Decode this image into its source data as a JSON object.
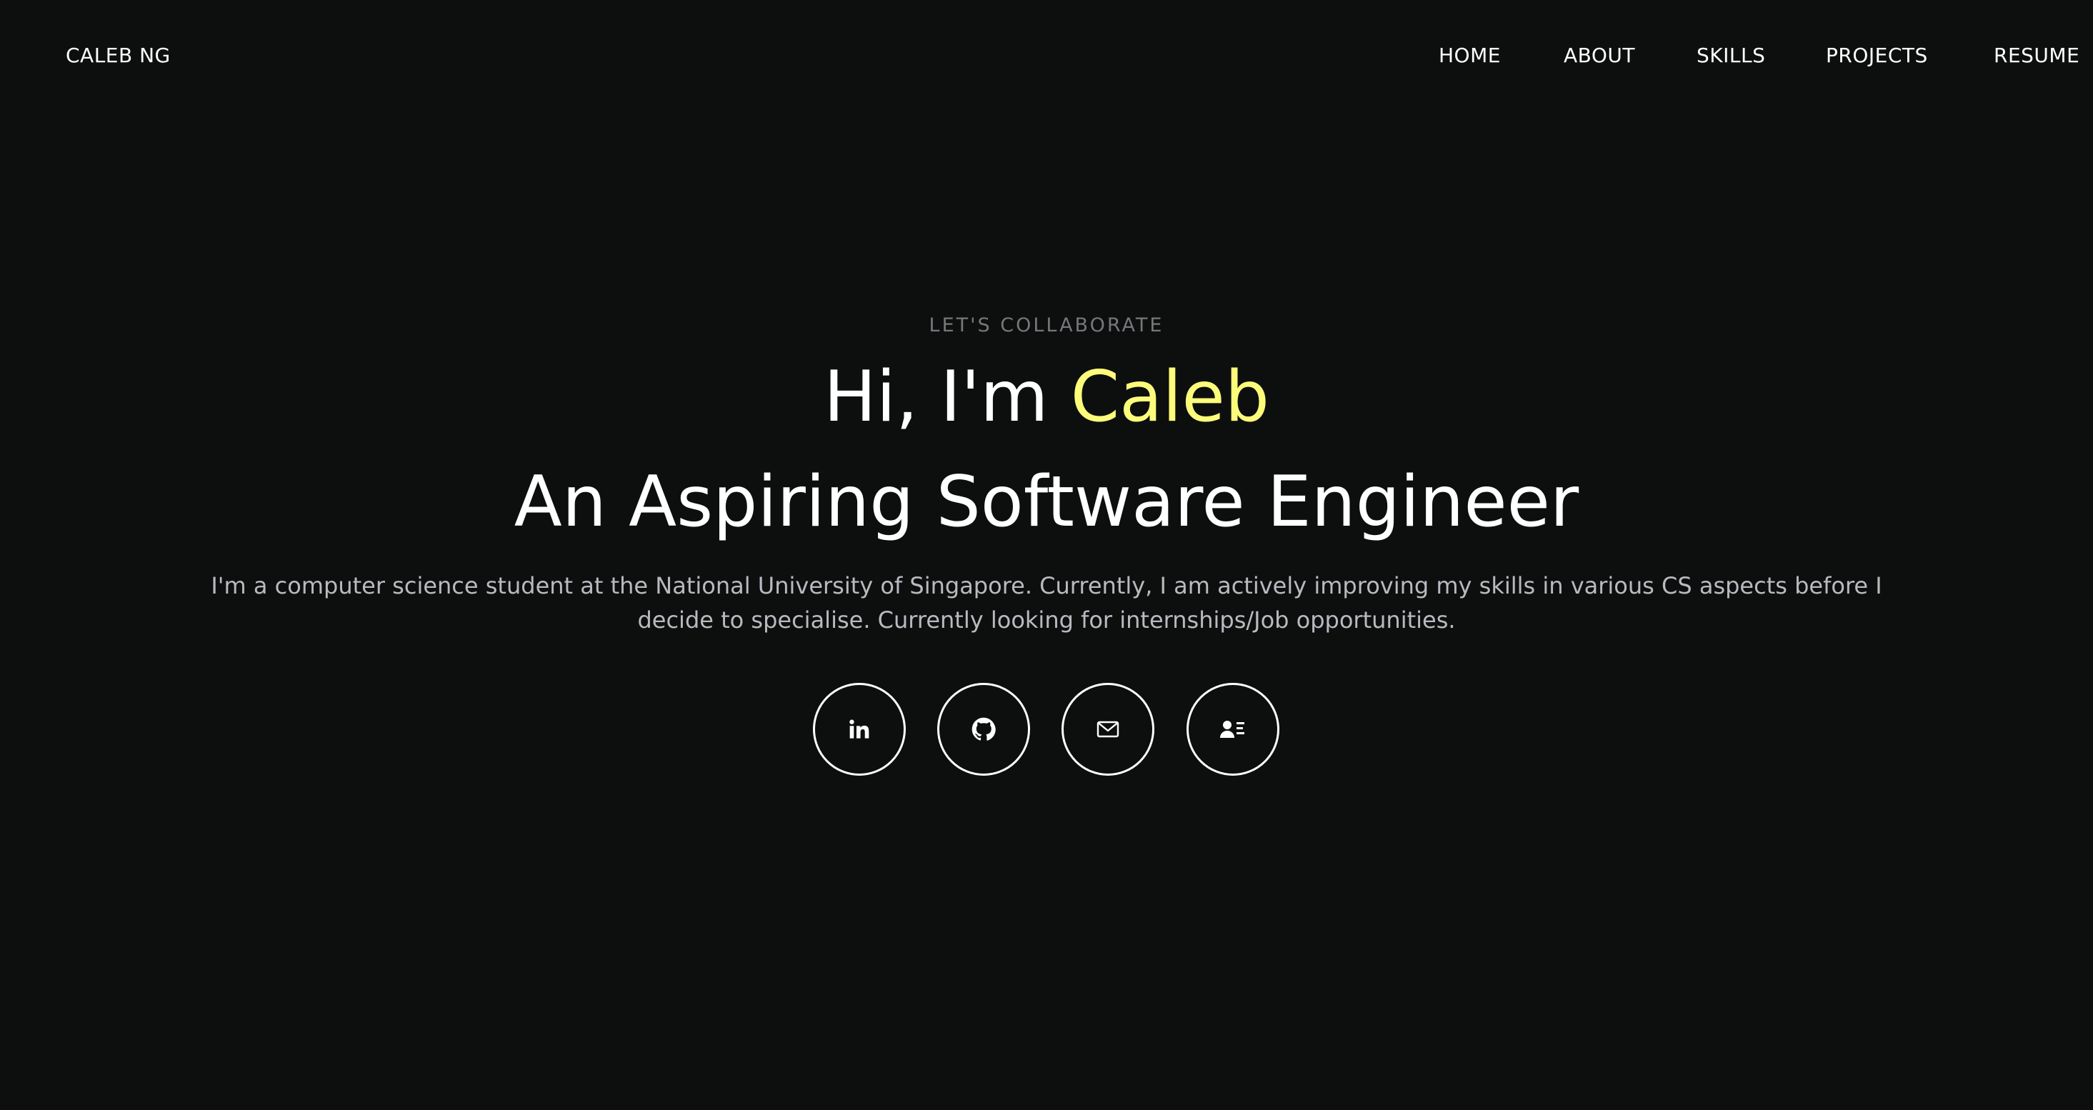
{
  "header": {
    "brand": "CALEB NG",
    "nav": [
      "HOME",
      "ABOUT",
      "SKILLS",
      "PROJECTS",
      "RESUME"
    ]
  },
  "hero": {
    "eyebrow": "LET'S COLLABORATE",
    "greeting_prefix": "Hi, I'm ",
    "greeting_name": "Caleb",
    "role": "An Aspiring Software Engineer",
    "description": "I'm a computer science student at the National University of Singapore. Currently, I am actively improving my skills in various CS aspects before I decide to specialise. Currently looking for internships/Job opportunities."
  },
  "socials": [
    {
      "icon": "linkedin-icon"
    },
    {
      "icon": "github-icon"
    },
    {
      "icon": "mail-icon"
    },
    {
      "icon": "contact-card-icon"
    }
  ],
  "colors": {
    "background": "#0d0f0f",
    "accent": "#fcfc7a",
    "text": "#ffffff",
    "muted": "#b9babf",
    "eyebrow": "#76777b"
  }
}
